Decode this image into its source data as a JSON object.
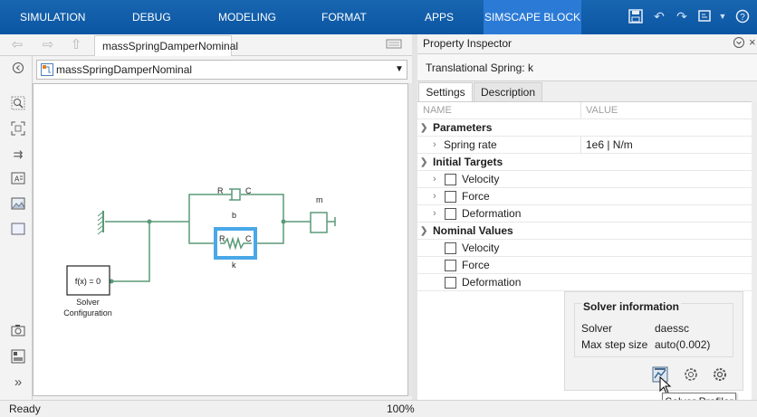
{
  "ribbon": {
    "tabs": [
      "SIMULATION",
      "DEBUG",
      "MODELING",
      "FORMAT",
      "APPS",
      "SIMSCAPE BLOCK"
    ],
    "active_tab": "SIMSCAPE BLOCK"
  },
  "editor": {
    "model_tab": "massSpringDamperNominal",
    "address": "massSpringDamperNominal",
    "diagram": {
      "damper_ports": [
        "R",
        "C"
      ],
      "damper_label": "b",
      "spring_ports": [
        "R",
        "C"
      ],
      "spring_label": "k",
      "mass_label": "m",
      "solver_block_text": "f(x) = 0",
      "solver_caption_line1": "Solver",
      "solver_caption_line2": "Configuration"
    }
  },
  "inspector": {
    "panel_title": "Property Inspector",
    "block_title": "Translational Spring: k",
    "tabs": [
      "Settings",
      "Description"
    ],
    "columns": {
      "name": "NAME",
      "value": "VALUE"
    },
    "sections": {
      "parameters": "Parameters",
      "initial_targets": "Initial Targets",
      "nominal_values": "Nominal Values"
    },
    "spring_rate": {
      "name": "Spring rate",
      "value": "1e6 | N/m"
    },
    "initial_items": [
      "Velocity",
      "Force",
      "Deformation"
    ],
    "nominal_items": [
      "Velocity",
      "Force",
      "Deformation"
    ]
  },
  "solver_info": {
    "title": "Solver information",
    "solver_label": "Solver",
    "solver_value": "daessc",
    "step_label": "Max step size",
    "step_value": "auto(0.002)",
    "tooltip": "Solver Profiler"
  },
  "status": {
    "left": "Ready",
    "zoom": "100%"
  },
  "colors": {
    "ribbon": "#0b56a3",
    "active_tab": "#2b7bd6",
    "wire": "#5a9a78",
    "selection": "#4aa8e8"
  }
}
